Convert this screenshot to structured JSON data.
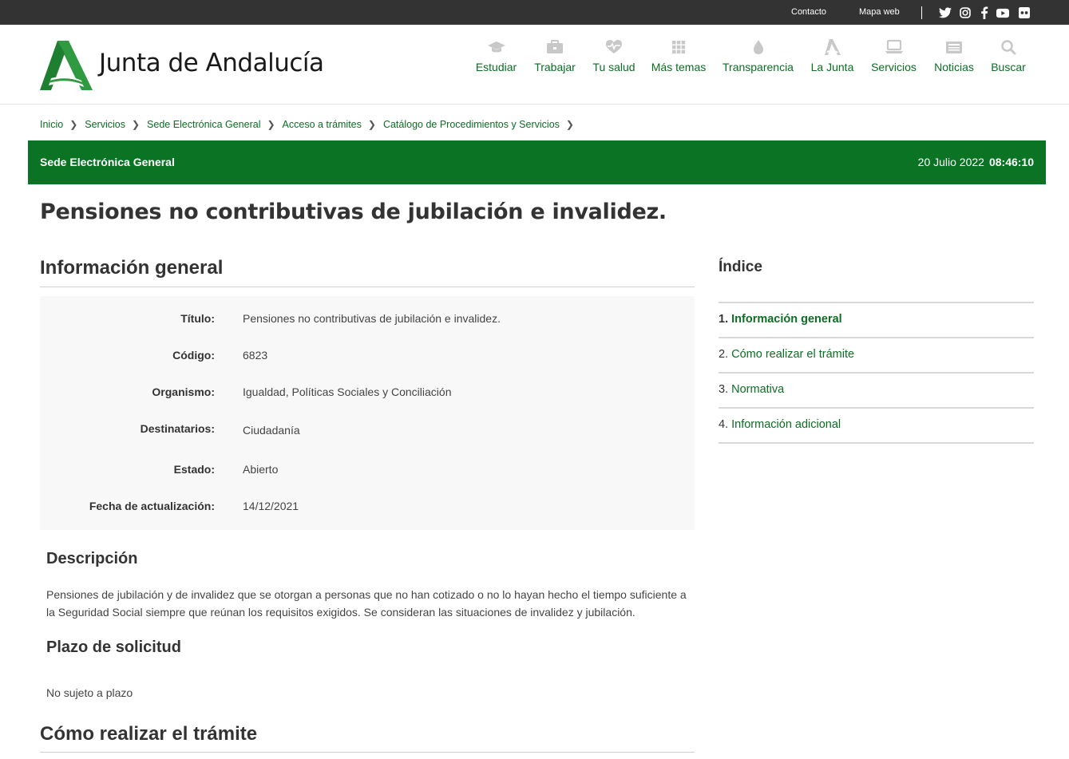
{
  "topbar": {
    "contact": "Contacto",
    "sitemap": "Mapa web",
    "social": [
      "twitter-icon",
      "instagram-icon",
      "facebook-icon",
      "youtube-icon",
      "flickr-icon"
    ]
  },
  "header": {
    "logo_text": "Junta de Andalucía",
    "nav": [
      {
        "label": "Estudiar",
        "icon": "graduation-cap-icon"
      },
      {
        "label": "Trabajar",
        "icon": "briefcase-icon"
      },
      {
        "label": "Tu salud",
        "icon": "heart-pulse-icon"
      },
      {
        "label": "Más temas",
        "icon": "grid-icon"
      },
      {
        "label": "Transparencia",
        "icon": "drop-icon"
      },
      {
        "label": "La Junta",
        "icon": "junta-logo-icon"
      },
      {
        "label": "Servicios",
        "icon": "laptop-icon"
      },
      {
        "label": "Noticias",
        "icon": "newspaper-icon"
      },
      {
        "label": "Buscar",
        "icon": "search-icon"
      }
    ]
  },
  "breadcrumb": [
    "Inicio",
    "Servicios",
    "Sede Electrónica General",
    "Acceso a trámites",
    "Catálogo de Procedimientos y Servicios"
  ],
  "band": {
    "title": "Sede Electrónica General",
    "date": "20 Julio 2022",
    "time": "08:46:10"
  },
  "page_title": "Pensiones no contributivas de jubilación e invalidez.",
  "general": {
    "heading": "Información general",
    "rows": [
      {
        "label": "Título:",
        "value": "Pensiones no contributivas de jubilación e invalidez."
      },
      {
        "label": "Código:",
        "value": "6823"
      },
      {
        "label": "Organismo:",
        "value": "Igualdad, Políticas Sociales y Conciliación"
      },
      {
        "label": "Destinatarios:",
        "value": "Ciudadanía"
      },
      {
        "label": "Estado:",
        "value": "Abierto"
      },
      {
        "label": "Fecha de actualización:",
        "value": "14/12/2021"
      }
    ]
  },
  "description": {
    "heading": "Descripción",
    "text": "Pensiones de jubilación y de invalidez que se otorgan a personas que no han cotizado o no lo hayan hecho el tiempo suficiente a la Seguridad Social siempre que reúnan los requisitos exigidos. Se consideran las situaciones de invalidez y jubilación."
  },
  "deadline": {
    "heading": "Plazo de solicitud",
    "text": "No sujeto a plazo"
  },
  "how": {
    "heading": "Cómo realizar el trámite"
  },
  "index": {
    "title": "Índice",
    "items": [
      {
        "num": "1.",
        "label": "Información general"
      },
      {
        "num": "2.",
        "label": "Cómo realizar el trámite"
      },
      {
        "num": "3.",
        "label": "Normativa"
      },
      {
        "num": "4.",
        "label": "Información adicional"
      }
    ]
  },
  "colors": {
    "brand_green": "#0b7324",
    "link_green": "#0b6e23",
    "topbar": "#333333",
    "nav_icon": "#c8c8c8"
  }
}
